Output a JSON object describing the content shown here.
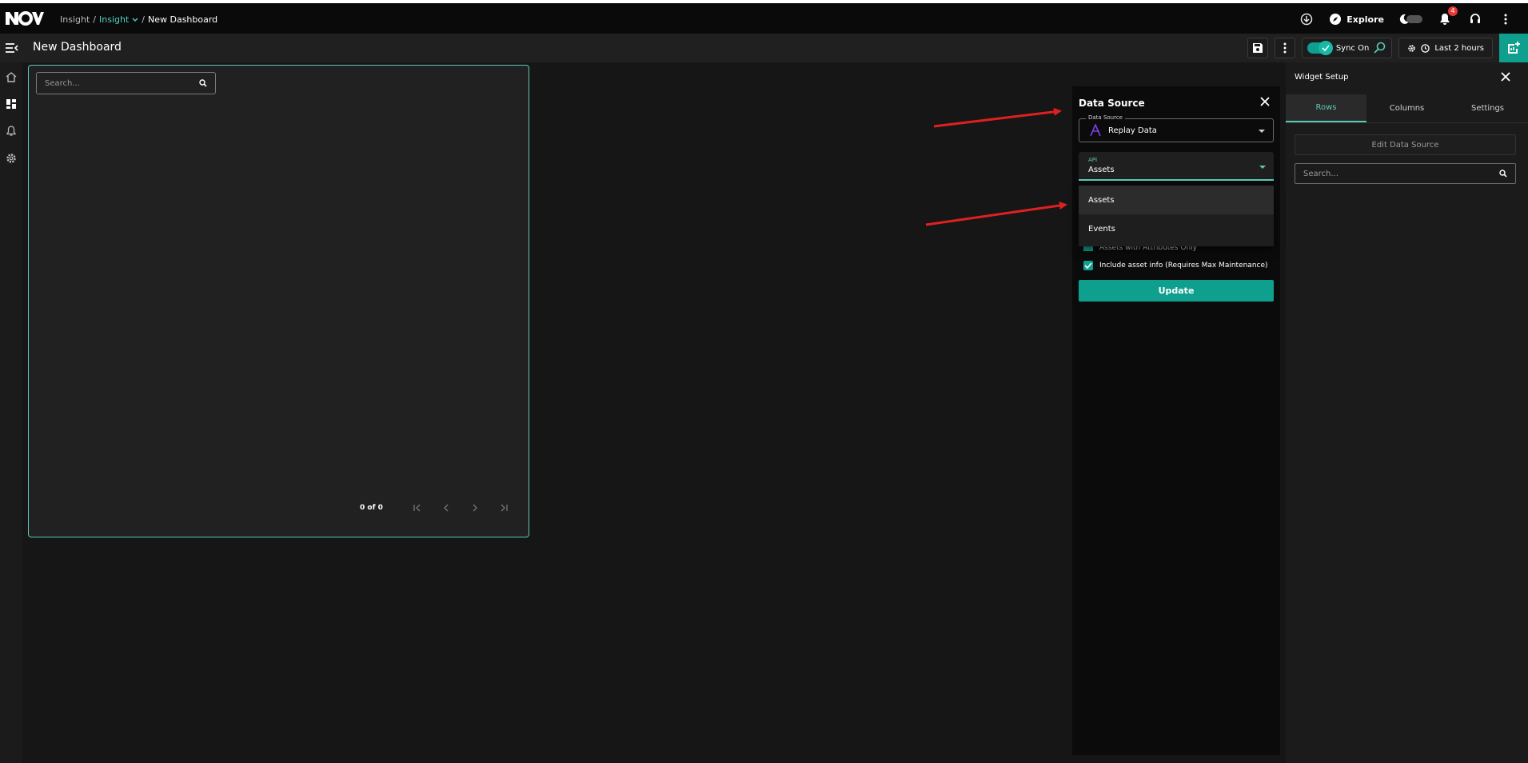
{
  "header": {
    "breadcrumb": [
      {
        "label": "Insight",
        "sep": "/"
      },
      {
        "label": "Insight",
        "sep": "/"
      },
      {
        "label": "New Dashboard"
      }
    ],
    "explore_label": "Explore",
    "notification_count": "4"
  },
  "subbar": {
    "page_title": "New Dashboard",
    "sync_label": "Sync On",
    "time_label": "Last 2 hours"
  },
  "widget": {
    "search_placeholder": "Search...",
    "pager_count": "0 of 0"
  },
  "data_source_panel": {
    "title": "Data Source",
    "source_label": "Data Source",
    "source_value": "Replay Data",
    "api_label": "API",
    "api_value": "Assets",
    "options": [
      "Assets",
      "Events"
    ],
    "partial_checkbox": "Assets with Attributes Only",
    "include_label": "Include asset info (Requires Max Maintenance)",
    "update_label": "Update"
  },
  "widget_setup": {
    "title": "Widget Setup",
    "tabs": [
      "Rows",
      "Columns",
      "Settings"
    ],
    "edit_label": "Edit Data Source",
    "search_placeholder": "Search..."
  },
  "colors": {
    "accent": "#0e9f8e",
    "accent_light": "#5bc9b6",
    "arrow": "#e02020",
    "badge": "#e53935"
  }
}
